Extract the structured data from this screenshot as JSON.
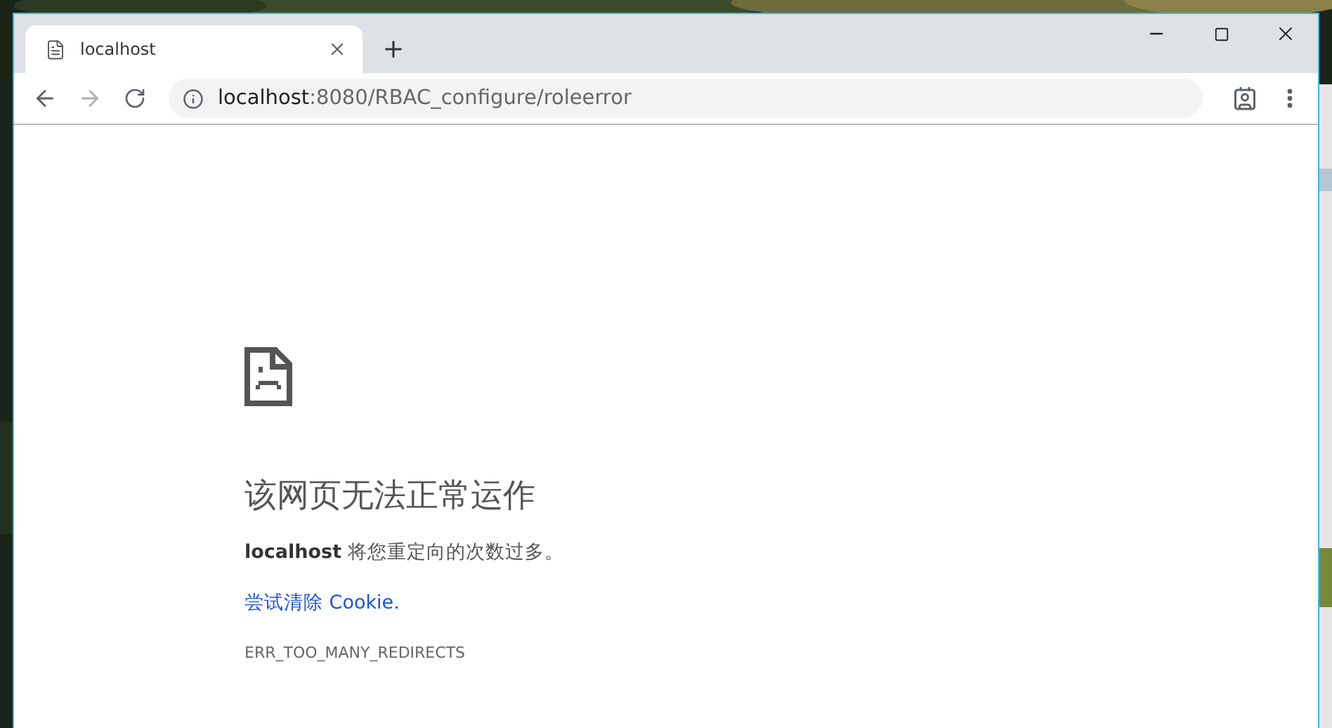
{
  "tabs": [
    {
      "title": "localhost",
      "selected": true
    }
  ],
  "address_bar": {
    "host": "localhost",
    "path": ":8080/RBAC_configure/roleerror"
  },
  "error_page": {
    "heading": "该网页无法正常运作",
    "message": "**localhost** 将您重定向的次数过多。",
    "link": "尝试清除 Cookie.",
    "code": "ERR_TOO_MANY_REDIRECTS"
  }
}
